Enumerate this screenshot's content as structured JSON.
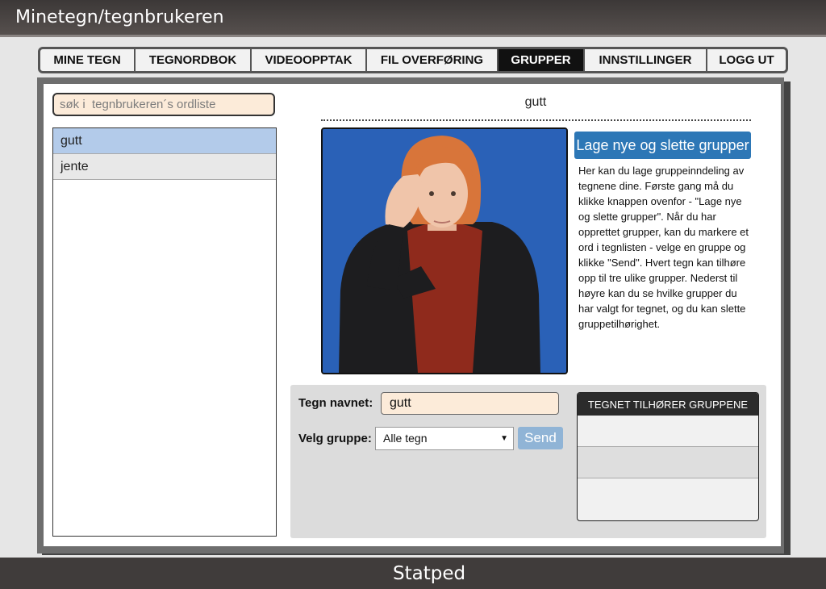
{
  "app": {
    "title": "Minetegn/tegnbrukeren"
  },
  "nav": {
    "tabs": [
      {
        "label": "MINE TEGN"
      },
      {
        "label": "TEGNORDBOK"
      },
      {
        "label": "VIDEOOPPTAK"
      },
      {
        "label": "FIL OVERFØRING"
      },
      {
        "label": "GRUPPER",
        "active": true
      },
      {
        "label": "INNSTILLINGER"
      },
      {
        "label": "LOGG UT"
      }
    ]
  },
  "search": {
    "placeholder": "søk i  tegnbrukeren´s ordliste"
  },
  "wordlist": {
    "items": [
      {
        "label": "gutt",
        "selected": true
      },
      {
        "label": "jente"
      }
    ]
  },
  "main": {
    "word_title": "gutt",
    "groups_button": "Lage nye og slette grupper",
    "info_text": "Her kan du lage gruppeinndeling av tegnene dine. Første gang må du klikke knappen ovenfor - \"Lage nye og slette grupper\". Når du har opprettet grupper, kan du markere et ord i tegnlisten - velge en gruppe og klikke \"Send\". Hvert tegn kan tilhøre opp til tre ulike grupper. Nederst til høyre kan du se hvilke grupper du har valgt for tegnet, og du kan slette gruppetilhørighet."
  },
  "form": {
    "name_label": "Tegn navnet:",
    "name_value": "gutt",
    "group_label": "Velg gruppe:",
    "group_selected": "Alle tegn",
    "send_label": "Send"
  },
  "groups_table": {
    "header": "TEGNET TILHØRER GRUPPENE",
    "rows": [
      "",
      "",
      ""
    ]
  },
  "footer": {
    "brand": "Statped"
  },
  "colors": {
    "accent": "#2d77b6",
    "active_tab": "#111111",
    "selection": "#b3cbea",
    "input_bg": "#fcebd9"
  }
}
